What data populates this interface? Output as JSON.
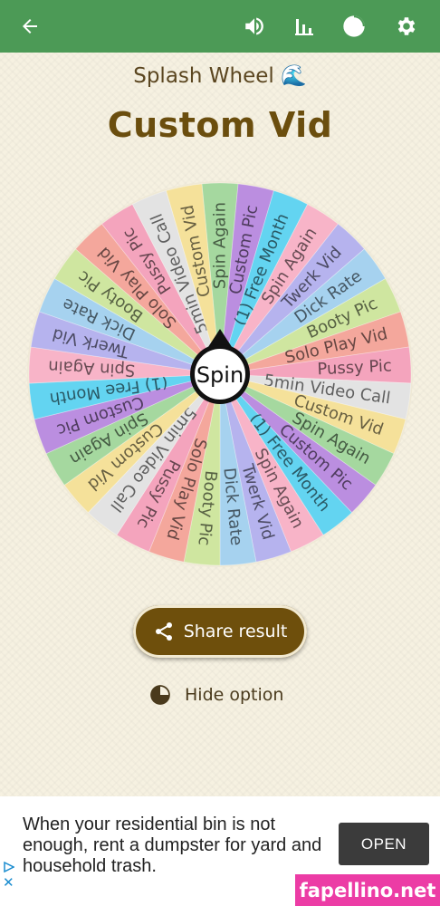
{
  "appbar": {
    "back_icon": "arrow-left-icon",
    "sound_icon": "volume-icon",
    "stats_icon": "bar-chart-icon",
    "pie_icon": "pie-chart-icon",
    "settings_icon": "gear-icon",
    "bg_color": "#4c9a56"
  },
  "header": {
    "subtitle": "Splash Wheel 🌊",
    "title": "Custom Vid"
  },
  "wheel": {
    "center_label": "Spin",
    "segments": [
      {
        "label": "Spin Again",
        "color": "#a5d89f"
      },
      {
        "label": "Custom Pic",
        "color": "#bb8ee0"
      },
      {
        "label": "(1) Free Month",
        "color": "#63d4f1"
      },
      {
        "label": "Spin Again",
        "color": "#f8b4c8"
      },
      {
        "label": "Twerk Vid",
        "color": "#b6b3ee"
      },
      {
        "label": "Dick Rate",
        "color": "#a6d2ef"
      },
      {
        "label": "Booty Pic",
        "color": "#cfe6a0"
      },
      {
        "label": "Solo Play Vid",
        "color": "#f4a79c"
      },
      {
        "label": "Pussy Pic",
        "color": "#f4a4bd"
      },
      {
        "label": "5min Video Call",
        "color": "#e3e3e3"
      },
      {
        "label": "Custom Vid",
        "color": "#f5e19a"
      },
      {
        "label": "Spin Again",
        "color": "#a5d89f"
      },
      {
        "label": "Custom Pic",
        "color": "#bb8ee0"
      },
      {
        "label": "(1) Free Month",
        "color": "#63d4f1"
      },
      {
        "label": "Spin Again",
        "color": "#f8b4c8"
      },
      {
        "label": "Twerk Vid",
        "color": "#b6b3ee"
      },
      {
        "label": "Dick Rate",
        "color": "#a6d2ef"
      },
      {
        "label": "Booty Pic",
        "color": "#cfe6a0"
      },
      {
        "label": "Solo Play Vid",
        "color": "#f4a79c"
      },
      {
        "label": "Pussy Pic",
        "color": "#f4a4bd"
      },
      {
        "label": "5min Video Call",
        "color": "#e3e3e3"
      },
      {
        "label": "Custom Vid",
        "color": "#f5e19a"
      },
      {
        "label": "Spin Again",
        "color": "#a5d89f"
      },
      {
        "label": "Custom Pic",
        "color": "#bb8ee0"
      },
      {
        "label": "(1) Free Month",
        "color": "#63d4f1"
      },
      {
        "label": "Spin Again",
        "color": "#f8b4c8"
      },
      {
        "label": "Twerk Vid",
        "color": "#b6b3ee"
      },
      {
        "label": "Dick Rate",
        "color": "#a6d2ef"
      },
      {
        "label": "Booty Pic",
        "color": "#cfe6a0"
      },
      {
        "label": "Solo Play Vid",
        "color": "#f4a79c"
      },
      {
        "label": "Pussy Pic",
        "color": "#f4a4bd"
      },
      {
        "label": "5min Video Call",
        "color": "#e3e3e3"
      },
      {
        "label": "Custom Vid",
        "color": "#f5e19a"
      }
    ]
  },
  "actions": {
    "share_label": "Share result",
    "share_icon": "share-icon",
    "hide_label": "Hide option",
    "hide_icon": "pie-chart-icon"
  },
  "ad": {
    "text": "When your residential bin is not enough, rent a dumpster for yard and household trash.",
    "button_label": "OPEN",
    "close_glyph": "✕"
  },
  "watermark": "fapellino.net"
}
